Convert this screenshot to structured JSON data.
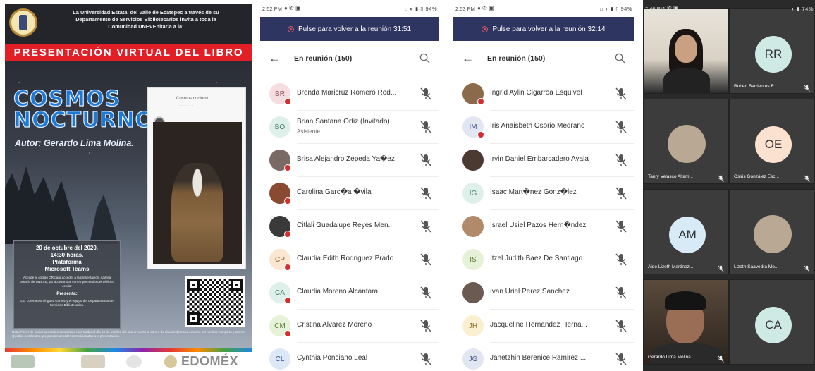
{
  "poster": {
    "intro_lines": [
      "La Universidad Estatal del Valle de Ecatepec a través de su",
      "Departamento de Servicios Bibliotecarios invita a toda la",
      "Comunidad UNEVEnitaria a la:"
    ],
    "banner": "PRESENTACIÓN VIRTUAL DEL LIBRO",
    "title_line1": "COSMOS",
    "title_line2": "NOCTURNO",
    "author": "Autor: Gerardo Lima Molina.",
    "book_cover_title": "Cosmos nocturno",
    "event_date": "20 de octubre del 2020.",
    "event_time": "14:30 horas.",
    "event_platform_label": "Plataforma",
    "event_platform": "Microsoft Teams",
    "info_text": "Accede al código QR para acceder a la presentación. Al área usuario de UNEVE, y/o accesorio al correo por medio del teléfono celular",
    "presenta_label": "Presenta:",
    "presenta_text": "Lic. Lorena Domínguez Gómez y el equipo del Departamento de Servicios Bibliotecarios.",
    "note": "Nota: Favor de enviar tu nombre completo a más tardar el día 19 de octubre del año en curso al correo de difusion@uneve.edu.mx, así nombre completo y correo. Quedan pendientes que puedan acceder como invitados a la presentación.",
    "footer_brand": "EDOMÉX"
  },
  "phone1": {
    "status_time": "2:52 PM",
    "status_right": "94%",
    "banner_text": "Pulse para volver a la reunión 31:51",
    "header_title": "En reunión (150)",
    "participants": [
      {
        "initials": "BR",
        "name": "Brenda Maricruz Romero Rod...",
        "sub": "",
        "bg": "#f6dde0",
        "fg": "#8a4a52",
        "dot": true
      },
      {
        "initials": "BO",
        "name": "Brian Santana Ortiz (Invitado)",
        "sub": "Asistente",
        "bg": "#dff0ea",
        "fg": "#3c7a66",
        "dot": false
      },
      {
        "initials": "",
        "name": "Brisa Alejandro Zepeda Ya�ez",
        "sub": "",
        "bg": "#7a6a66",
        "fg": "#fff",
        "dot": true
      },
      {
        "initials": "",
        "name": "Carolina Garc�a �vila",
        "sub": "",
        "bg": "#8a4a32",
        "fg": "#fff",
        "dot": true
      },
      {
        "initials": "",
        "name": "Citlali Guadalupe Reyes Men...",
        "sub": "",
        "bg": "#3a3a3a",
        "fg": "#fff",
        "dot": true
      },
      {
        "initials": "CP",
        "name": "Claudia Edith Rodriguez Prado",
        "sub": "",
        "bg": "#fbe6d2",
        "fg": "#8a5a2a",
        "dot": true
      },
      {
        "initials": "CA",
        "name": "Claudia Moreno Alcántara",
        "sub": "",
        "bg": "#dff0ea",
        "fg": "#3c7a66",
        "dot": true
      },
      {
        "initials": "CM",
        "name": "Cristina Alvarez Moreno",
        "sub": "",
        "bg": "#e6f2d8",
        "fg": "#5a7a32",
        "dot": true
      },
      {
        "initials": "CL",
        "name": "Cynthia Ponciano Leal",
        "sub": "",
        "bg": "#dde8f6",
        "fg": "#3a5a8a",
        "dot": false
      }
    ]
  },
  "phone2": {
    "status_time": "2:53 PM",
    "status_right": "94%",
    "banner_text": "Pulse para volver a la reunión 32:14",
    "header_title": "En reunión (150)",
    "participants": [
      {
        "initials": "",
        "name": "Ingrid Aylin Cigarroa Esquivel",
        "sub": "",
        "bg": "#8a6a4a",
        "fg": "#fff",
        "dot": true
      },
      {
        "initials": "IM",
        "name": "Iris Anaisbeth Osorio Medrano",
        "sub": "",
        "bg": "#e2e6f2",
        "fg": "#4a5a8a",
        "dot": true
      },
      {
        "initials": "",
        "name": "Irvin Daniel Embarcadero Ayala",
        "sub": "",
        "bg": "#4a3a32",
        "fg": "#fff",
        "dot": false
      },
      {
        "initials": "IG",
        "name": "Isaac Mart�nez Gonz�lez",
        "sub": "",
        "bg": "#dff0ea",
        "fg": "#3c7a66",
        "dot": false
      },
      {
        "initials": "",
        "name": "Israel Usiel Pazos Hern�ndez",
        "sub": "",
        "bg": "#b08a6a",
        "fg": "#fff",
        "dot": false
      },
      {
        "initials": "IS",
        "name": "Itzel Judith Baez De Santiago",
        "sub": "",
        "bg": "#e6f2d8",
        "fg": "#5a7a32",
        "dot": false
      },
      {
        "initials": "",
        "name": "Ivan Uriel Perez Sanchez",
        "sub": "",
        "bg": "#6a5a52",
        "fg": "#fff",
        "dot": false
      },
      {
        "initials": "JH",
        "name": "Jacqueline Hernandez Herna...",
        "sub": "",
        "bg": "#fbefd2",
        "fg": "#8a6a2a",
        "dot": false
      },
      {
        "initials": "JG",
        "name": "Janetzhin Berenice Ramirez ...",
        "sub": "",
        "bg": "#e2e6f2",
        "fg": "#4a5a8a",
        "dot": false
      }
    ]
  },
  "video": {
    "status_time": "2:46 PM",
    "status_right": "74%",
    "tiles": [
      {
        "kind": "photo-a",
        "initials": "",
        "caption": ""
      },
      {
        "kind": "initials",
        "initials": "RR",
        "caption": "Rubén Barrientos R...",
        "color": "teal"
      },
      {
        "kind": "circle",
        "initials": "",
        "caption": "Tanry Velasco Altam..."
      },
      {
        "kind": "initials",
        "initials": "OE",
        "caption": "Osiris González Esc...",
        "color": "peach"
      },
      {
        "kind": "initials",
        "initials": "AM",
        "caption": "Aide Lizeth Martinez...",
        "color": "lblue"
      },
      {
        "kind": "circle",
        "initials": "",
        "caption": "Lizeth Saavedra Mo..."
      },
      {
        "kind": "photo-c",
        "initials": "",
        "caption": "Gerardo Lima Molina"
      },
      {
        "kind": "initials",
        "initials": "CA",
        "caption": "",
        "color": "teal"
      }
    ]
  }
}
